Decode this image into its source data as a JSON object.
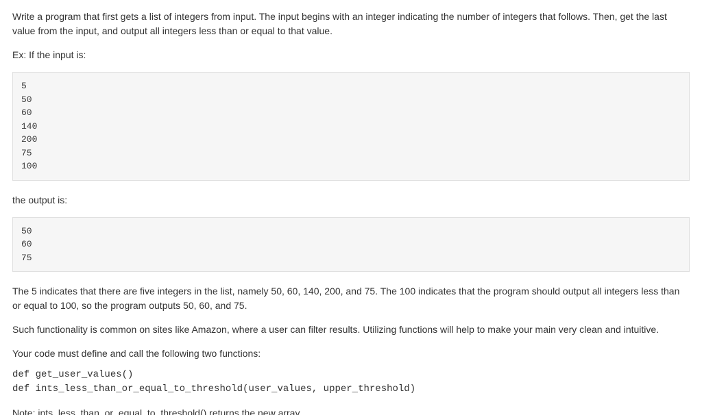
{
  "intro": "Write a program that first gets a list of integers from input. The input begins with an integer indicating the number of integers that follows. Then, get the last value from the input, and output all integers less than or equal to that value.",
  "ex_label": "Ex: If the input is:",
  "input_example": "5\n50\n60\n140\n200\n75\n100",
  "output_label": "the output is:",
  "output_example": "50\n60\n75",
  "explain1": "The 5 indicates that there are five integers in the list, namely 50, 60, 140, 200, and 75. The 100 indicates that the program should output all integers less than or equal to 100, so the program outputs 50, 60, and 75.",
  "explain2": "Such functionality is common on sites like Amazon, where a user can filter results. Utilizing functions will help to make your main very clean and intuitive.",
  "funcs_intro": "Your code must define and call the following two functions:",
  "func1": "def get_user_values()",
  "func2": "def ints_less_than_or_equal_to_threshold(user_values, upper_threshold)",
  "note": "Note: ints_less_than_or_equal_to_threshold() returns the new array."
}
